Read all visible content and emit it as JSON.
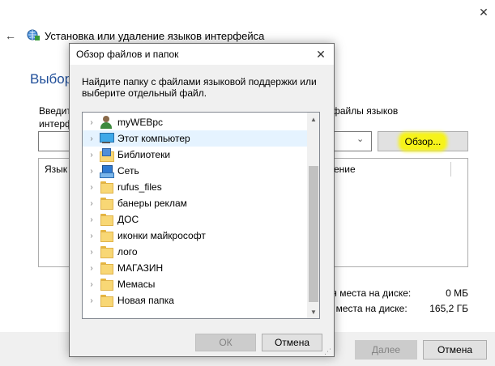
{
  "wizard": {
    "title": "Установка или удаление языков интерфейса",
    "heading_fragment": "Выбор",
    "instruction_left": [
      "Введит",
      "интерф"
    ],
    "instruction_right": "файлы языков",
    "browse_label": "Обзор...",
    "list_header_left": "Язык",
    "list_header_right": "ение",
    "space_required_label": "тся места на диске:",
    "space_required_value": "0 МБ",
    "space_available_label": "но места на диске:",
    "space_available_value": "165,2 ГБ",
    "next_label": "Далее",
    "cancel_label": "Отмена"
  },
  "dialog": {
    "title": "Обзор файлов и папок",
    "instruction": "Найдите папку с файлами языковой поддержки или выберите отдельный файл.",
    "ok_label": "ОК",
    "cancel_label": "Отмена",
    "items": [
      {
        "label": "myWEBpc",
        "icon": "user-icon"
      },
      {
        "label": "Этот компьютер",
        "icon": "pc-icon",
        "selected": true
      },
      {
        "label": "Библиотеки",
        "icon": "library-icon"
      },
      {
        "label": "Сеть",
        "icon": "network-icon"
      },
      {
        "label": "rufus_files",
        "icon": "folder-icon"
      },
      {
        "label": "банеры реклам",
        "icon": "folder-icon"
      },
      {
        "label": "ДОС",
        "icon": "folder-icon"
      },
      {
        "label": "иконки майкрософт",
        "icon": "folder-icon"
      },
      {
        "label": "лого",
        "icon": "folder-icon"
      },
      {
        "label": "МАГАЗИН",
        "icon": "folder-icon"
      },
      {
        "label": "Мемасы",
        "icon": "folder-icon"
      },
      {
        "label": "Новая папка",
        "icon": "folder-icon"
      }
    ]
  },
  "colors": {
    "accent_heading": "#1f4e99",
    "highlight": "#f6f31a",
    "selected_row": "#e5f3ff"
  }
}
